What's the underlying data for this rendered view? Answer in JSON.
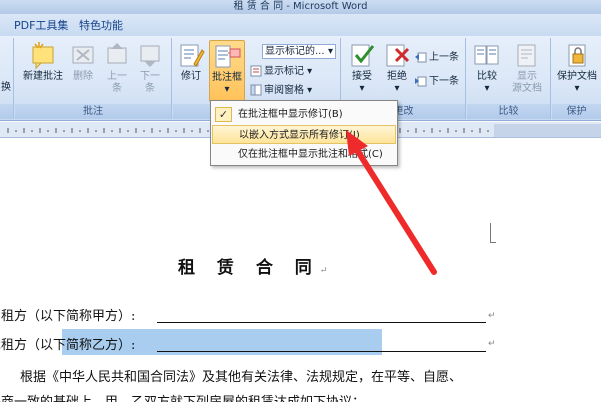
{
  "window": {
    "title": "租 赁 合 同 - Microsoft Word"
  },
  "tabs": [
    "PDF工具集",
    "特色功能"
  ],
  "ribbon": {
    "left_partial": "换",
    "groups": {
      "comments": {
        "label": "批注",
        "new_comment": "新建批注",
        "delete": "删除",
        "prev": [
          "上一",
          "条"
        ],
        "next": [
          "下一",
          "条"
        ]
      },
      "tracking": {
        "revise": "修订",
        "balloons": "批注框",
        "show_markup_select": "显示标记的...",
        "show_markup": "显示标记",
        "review_pane": "审阅窗格"
      },
      "changes": {
        "label": "更改",
        "accept": "接受",
        "reject": "拒绝",
        "prev": "上一条",
        "next": "下一条"
      },
      "compare": {
        "label": "比较",
        "compare": "比较",
        "show_source": [
          "显示",
          "源文档"
        ]
      },
      "protect": {
        "label": "保护",
        "protect_doc": "保护文档"
      }
    }
  },
  "balloons_menu": {
    "items": [
      {
        "label": "在批注框中显示修订(B)",
        "checked": true
      },
      {
        "label": "以嵌入方式显示所有修订(I)",
        "checked": false
      },
      {
        "label": "仅在批注框中显示批注和格式(C)",
        "checked": false
      }
    ]
  },
  "document": {
    "title": "租 赁 合 同",
    "para_mark": "↵",
    "line1": "出租方（以下简称甲方）:",
    "line2_prefix": "承租方（以",
    "line2_highlight": "下简称乙方）:",
    "line3": "根据《中华人民共和国合同法》及其他有关法律、法规规定，在平等、自愿、",
    "line4": "协商一致的基础上，甲、乙双方就下列房屋的租赁达成如下协议："
  },
  "colors": {
    "ribbon_bg": "#dbe7f7",
    "active_button": "#ffc25a",
    "highlight": "#a8cdef",
    "arrow": "#ef2a2a"
  }
}
